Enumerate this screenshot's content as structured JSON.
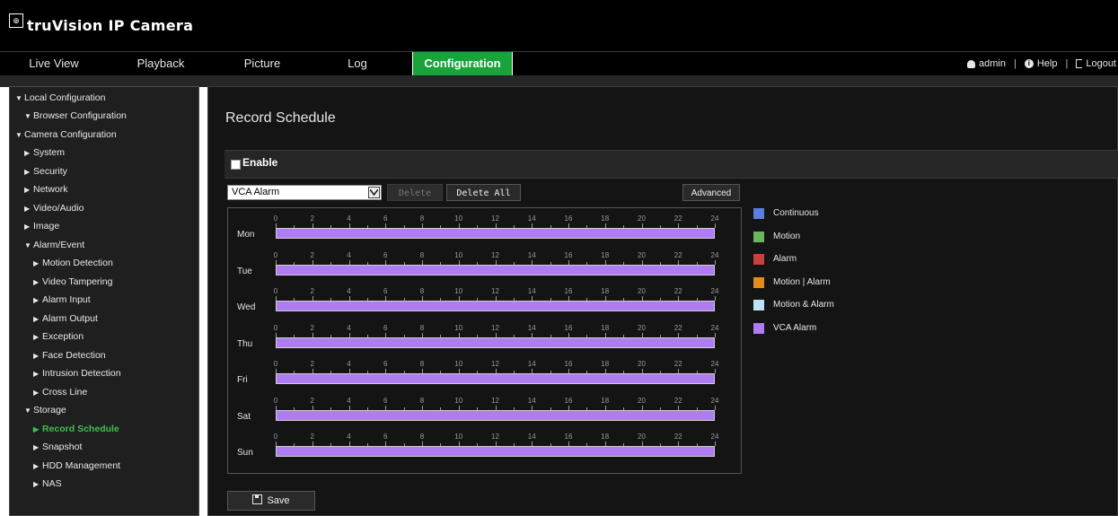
{
  "app": {
    "logo_mark": "⊕",
    "title": "truVision IP Camera"
  },
  "nav": {
    "tabs": [
      {
        "label": "Live View"
      },
      {
        "label": "Playback"
      },
      {
        "label": "Picture"
      },
      {
        "label": "Log"
      },
      {
        "label": "Configuration",
        "active": true
      }
    ],
    "user": "admin",
    "help": "Help",
    "logout": "Logout"
  },
  "sidebar": {
    "items": [
      {
        "label": "Local Configuration",
        "expanded": true
      },
      {
        "label": "Browser Configuration",
        "expanded": true
      },
      {
        "label": "Camera Configuration",
        "expanded": true
      },
      {
        "label": "System"
      },
      {
        "label": "Security"
      },
      {
        "label": "Network"
      },
      {
        "label": "Video/Audio"
      },
      {
        "label": "Image"
      },
      {
        "label": "Alarm/Event",
        "expanded": true
      },
      {
        "label": "Motion Detection"
      },
      {
        "label": "Video Tampering"
      },
      {
        "label": "Alarm Input"
      },
      {
        "label": "Alarm Output"
      },
      {
        "label": "Exception"
      },
      {
        "label": "Face Detection"
      },
      {
        "label": "Intrusion Detection"
      },
      {
        "label": "Cross Line"
      },
      {
        "label": "Storage",
        "expanded": true
      },
      {
        "label": "Record Schedule",
        "current": true
      },
      {
        "label": "Snapshot"
      },
      {
        "label": "HDD Management"
      },
      {
        "label": "NAS"
      }
    ]
  },
  "page": {
    "title": "Record Schedule",
    "enable_label": "Enable",
    "enable_checked": false,
    "record_type": "VCA Alarm",
    "delete_label": "Delete",
    "delete_all_label": "Delete All",
    "advanced_label": "Advanced",
    "save_label": "Save"
  },
  "schedule": {
    "days": [
      "Mon",
      "Tue",
      "Wed",
      "Thu",
      "Fri",
      "Sat",
      "Sun"
    ],
    "hour_labels": [
      "0",
      "2",
      "4",
      "6",
      "8",
      "10",
      "12",
      "14",
      "16",
      "18",
      "20",
      "22",
      "24"
    ],
    "bars": [
      {
        "day": "Mon",
        "start": 0,
        "end": 24,
        "type": "VCA Alarm"
      },
      {
        "day": "Tue",
        "start": 0,
        "end": 24,
        "type": "VCA Alarm"
      },
      {
        "day": "Wed",
        "start": 0,
        "end": 24,
        "type": "VCA Alarm"
      },
      {
        "day": "Thu",
        "start": 0,
        "end": 24,
        "type": "VCA Alarm"
      },
      {
        "day": "Fri",
        "start": 0,
        "end": 24,
        "type": "VCA Alarm"
      },
      {
        "day": "Sat",
        "start": 0,
        "end": 24,
        "type": "VCA Alarm"
      },
      {
        "day": "Sun",
        "start": 0,
        "end": 24,
        "type": "VCA Alarm"
      }
    ]
  },
  "legend": [
    {
      "label": "Continuous",
      "color": "#5b7fe0"
    },
    {
      "label": "Motion",
      "color": "#6cb55b"
    },
    {
      "label": "Alarm",
      "color": "#c8413f"
    },
    {
      "label": "Motion | Alarm",
      "color": "#e58a1f"
    },
    {
      "label": "Motion & Alarm",
      "color": "#bfe1f7"
    },
    {
      "label": "VCA Alarm",
      "color": "#b07cf3"
    }
  ],
  "colors": {
    "accent": "#19a33b",
    "current_item": "#3fc04f",
    "vca": "#b07cf3"
  }
}
